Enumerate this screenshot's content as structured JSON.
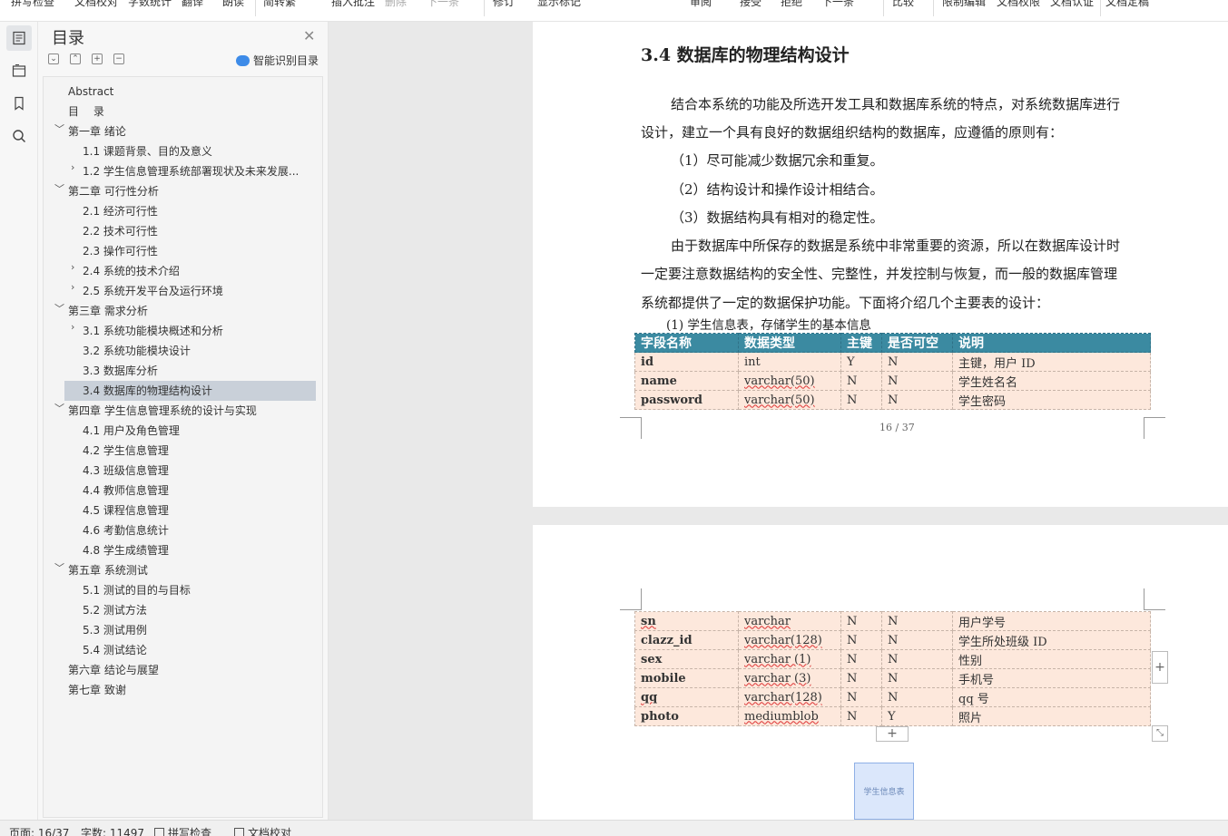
{
  "toolbar": {
    "items": [
      "拼写检查",
      "文档校对",
      "字数统计",
      "翻译",
      "朗读",
      "简转繁",
      "插入批注",
      "删除",
      "下一条",
      "修订",
      "显示标记",
      "审阅",
      "接受",
      "拒绝",
      "下一条",
      "比较",
      "限制编辑",
      "文档权限",
      "文档认证",
      "文档定稿"
    ]
  },
  "toc": {
    "title": "目录",
    "smart_label": "智能识别目录",
    "items": [
      {
        "label": "Abstract"
      },
      {
        "label": "目　 录"
      },
      {
        "label": "第一章  绪论"
      },
      {
        "label": "1.1  课题背景、目的及意义"
      },
      {
        "label": "1.2  学生信息管理系统部署现状及未来发展..."
      },
      {
        "label": "第二章  可行性分析"
      },
      {
        "label": "2.1  经济可行性"
      },
      {
        "label": "2.2  技术可行性"
      },
      {
        "label": "2.3  操作可行性"
      },
      {
        "label": "2.4  系统的技术介绍"
      },
      {
        "label": "2.5  系统开发平台及运行环境"
      },
      {
        "label": "第三章  需求分析"
      },
      {
        "label": "3.1  系统功能模块概述和分析"
      },
      {
        "label": "3.2  系统功能模块设计"
      },
      {
        "label": "3.3  数据库分析"
      },
      {
        "label": "3.4  数据库的物理结构设计"
      },
      {
        "label": "第四章  学生信息管理系统的设计与实现"
      },
      {
        "label": "4.1    用户及角色管理"
      },
      {
        "label": "4.2    学生信息管理"
      },
      {
        "label": "4.3    班级信息管理"
      },
      {
        "label": "4.4    教师信息管理"
      },
      {
        "label": "4.5    课程信息管理"
      },
      {
        "label": "4.6    考勤信息统计"
      },
      {
        "label": "4.8  学生成绩管理"
      },
      {
        "label": "第五章  系统测试"
      },
      {
        "label": "5.1  测试的目的与目标"
      },
      {
        "label": "5.2  测试方法"
      },
      {
        "label": "5.3  测试用例"
      },
      {
        "label": "5.4  测试结论"
      },
      {
        "label": "第六章  结论与展望"
      },
      {
        "label": "第七章  致谢"
      }
    ]
  },
  "document": {
    "heading": "3.4  数据库的物理结构设计",
    "paragraphs": [
      "结合本系统的功能及所选开发工具和数据库系统的特点，对系统数据库进行",
      "设计，建立一个具有良好的数据组织结构的数据库，应遵循的原则有：",
      "（1）尽可能减少数据冗余和重复。",
      "（2）结构设计和操作设计相结合。",
      "（3）数据结构具有相对的稳定性。",
      "由于数据库中所保存的数据是系统中非常重要的资源，所以在数据库设计时",
      "一定要注意数据结构的安全性、完整性，并发控制与恢复，而一般的数据库管理",
      "系统都提供了一定的数据保护功能。下面将介绍几个主要表的设计："
    ],
    "caption": "(1) 学生信息表，存储学生的基本信息",
    "table_header": [
      "字段名称",
      "数据类型",
      "主键",
      "是否可空",
      "说明"
    ],
    "table_rows_page1": [
      [
        "id",
        "int",
        "Y",
        "N",
        "主键，用户 ID"
      ],
      [
        "name",
        "varchar(50)",
        "N",
        "N",
        "学生姓名名"
      ],
      [
        "password",
        "varchar(50)",
        "N",
        "N",
        "学生密码"
      ]
    ],
    "page_number": "16 / 37",
    "table_rows_page2": [
      [
        "sn",
        "varchar",
        "N",
        "N",
        "用户学号"
      ],
      [
        "clazz_id",
        "varchar(128)",
        "N",
        "N",
        "学生所处班级 ID"
      ],
      [
        "sex",
        "varchar (1)",
        "N",
        "N",
        "性别"
      ],
      [
        "mobile",
        "varchar (3)",
        "N",
        "N",
        "手机号"
      ],
      [
        "qq",
        "varchar(128)",
        "N",
        "N",
        "qq 号"
      ],
      [
        "photo",
        "mediumblob",
        "N",
        "Y",
        "照片"
      ]
    ],
    "caption_box": "学生信息表"
  },
  "status": {
    "page": "页面: 16/37",
    "words": "字数: 11497",
    "spell": "拼写检查",
    "proof": "文档校对"
  }
}
